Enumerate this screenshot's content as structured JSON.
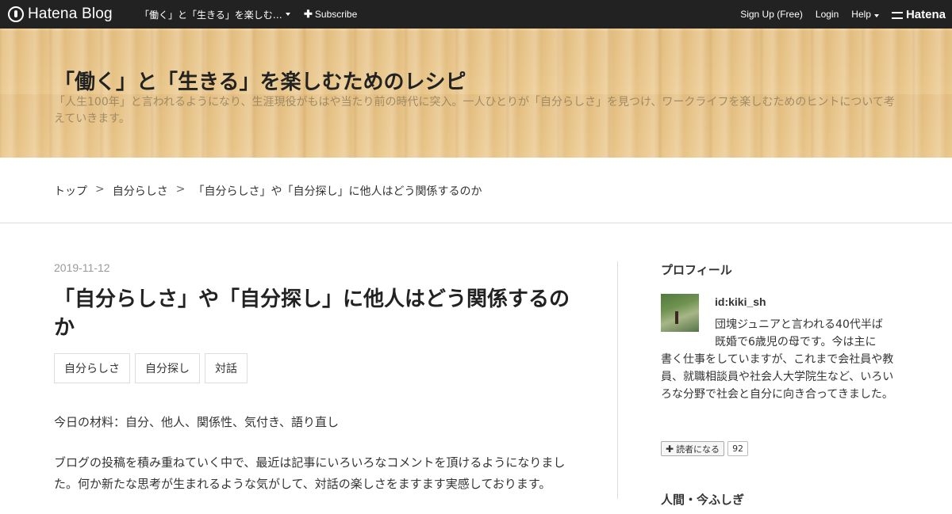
{
  "topbar": {
    "logo_text": "Hatena Blog",
    "blog_menu_label": "「働く」と「生きる」を楽しむ…",
    "subscribe_label": "Subscribe",
    "signup_label": "Sign Up (Free)",
    "login_label": "Login",
    "help_label": "Help",
    "hatena_label": "Hatena"
  },
  "header": {
    "title": "「働く」と「生きる」を楽しむためのレシピ",
    "description": "「人生100年」と言われるようになり、生涯現役がもはや当たり前の時代に突入。一人ひとりが「自分らしさ」を見つけ、ワークライフを楽しむためのヒントについて考えていきます。"
  },
  "breadcrumb": {
    "items": [
      "トップ",
      "自分らしさ",
      "「自分らしさ」や「自分探し」に他人はどう関係するのか"
    ],
    "separator": ">"
  },
  "entry": {
    "date": "2019-11-12",
    "title": "「自分らしさ」や「自分探し」に他人はどう関係するのか",
    "tags": [
      "自分らしさ",
      "自分探し",
      "対話"
    ],
    "paragraphs": [
      "今日の材料：自分、他人、関係性、気付き、語り直し",
      "ブログの投稿を積み重ねていく中で、最近は記事にいろいろなコメントを頂けるようになりました。何か新たな思考が生まれるような気がして、対話の楽しさをますます実感しております。"
    ]
  },
  "sidebar": {
    "profile_title": "プロフィール",
    "profile_id": "id:kiki_sh",
    "profile_desc_lines": [
      "団塊ジュニアと言われる40代半ば",
      "既婚で6歳児の母です。今は主に"
    ],
    "profile_desc_rest": "書く仕事をしていますが、これまで会社員や教員、就職相談員や社会人大学院生など、いろいろな分野で社会と自分に向き合ってきました。",
    "subscribe_label": "読者になる",
    "subscriber_count": "92",
    "next_title": "人間・今ふしぎ"
  },
  "colors": {
    "topbar_bg": "#222222",
    "header_wood": "#e8c58a"
  }
}
